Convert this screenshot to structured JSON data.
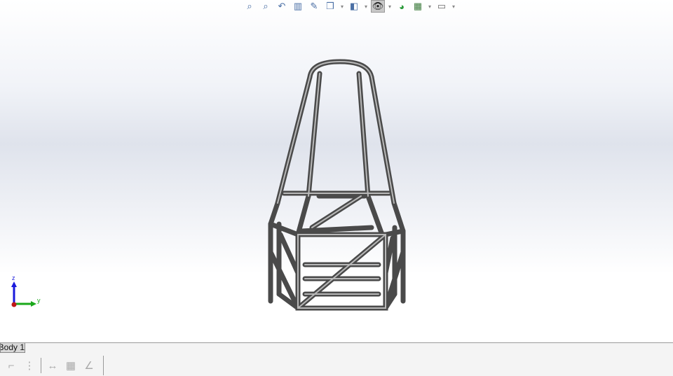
{
  "viewport": {
    "model": "tube frame chassis"
  },
  "heads_up_toolbar": {
    "items": [
      {
        "name": "zoom-to-fit-icon",
        "glyph": "⌕"
      },
      {
        "name": "zoom-to-area-icon",
        "glyph": "⌕"
      },
      {
        "name": "previous-view-icon",
        "glyph": "↶"
      },
      {
        "name": "section-view-icon",
        "glyph": "▥"
      },
      {
        "name": "dynamic-annotation-icon",
        "glyph": "✎"
      },
      {
        "name": "view-orientation-icon",
        "glyph": "❒"
      },
      {
        "name": "display-style-icon",
        "glyph": "◧"
      },
      {
        "name": "hide-show-items-icon",
        "glyph": "👁"
      },
      {
        "name": "edit-appearance-icon",
        "glyph": "◕"
      },
      {
        "name": "apply-scene-icon",
        "glyph": "▦"
      },
      {
        "name": "view-settings-icon",
        "glyph": "▭"
      }
    ]
  },
  "triad": {
    "z_label": "z",
    "y_label": "y",
    "colors": {
      "z": "#1a1adc",
      "y": "#1aa81a",
      "x": "#c01818"
    }
  },
  "bottom_tab": {
    "label": "Body 1"
  },
  "sketch_tools": [
    {
      "name": "corner-icon",
      "glyph": "⌐"
    },
    {
      "name": "dotted-line-icon",
      "glyph": "⋮"
    },
    {
      "name": "dimension-icon",
      "glyph": "↔"
    },
    {
      "name": "grid-icon",
      "glyph": "▦"
    },
    {
      "name": "angle-icon",
      "glyph": "∠"
    }
  ]
}
